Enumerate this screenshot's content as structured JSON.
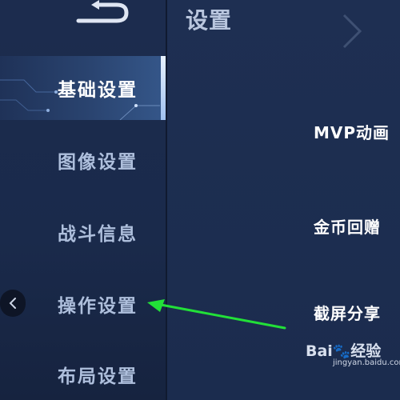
{
  "header": {
    "title": "设置"
  },
  "sidebar": {
    "items": [
      {
        "label": "基础设置",
        "active": true
      },
      {
        "label": "图像设置",
        "active": false
      },
      {
        "label": "战斗信息",
        "active": false
      },
      {
        "label": "操作设置",
        "active": false
      },
      {
        "label": "布局设置",
        "active": false
      }
    ]
  },
  "main": {
    "settings": [
      {
        "label": "MVP动画"
      },
      {
        "label": "金币回赠"
      },
      {
        "label": "截屏分享"
      }
    ]
  },
  "annotation": {
    "arrow_color": "#22e038"
  },
  "watermark": {
    "brand_left": "Bai",
    "brand_right": "经验",
    "url": "jingyan.baidu.com"
  },
  "colors": {
    "accent_active": "#35578a",
    "text_default": "#aebfdc"
  }
}
